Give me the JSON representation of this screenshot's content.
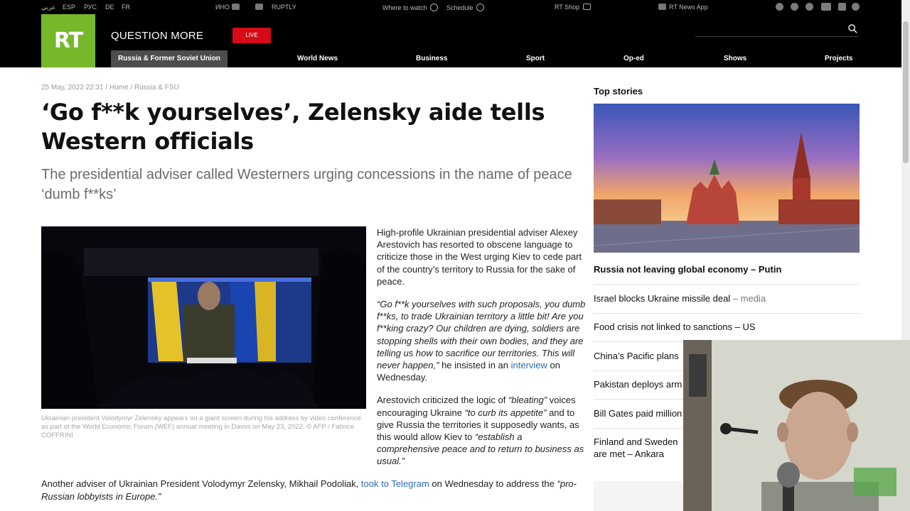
{
  "top_bar": {
    "languages": [
      "عربي",
      "ESP",
      "РУС",
      "DE",
      "FR"
    ],
    "partners": [
      "ИНО",
      "RUPTLY"
    ],
    "where_to_watch": "Where to watch",
    "schedule": "Schedule",
    "shop": "RT Shop",
    "news_app": "RT News App"
  },
  "header": {
    "logo": "RT",
    "tagline": "QUESTION MORE",
    "live_label": "LIVE",
    "search_placeholder": "",
    "nav": [
      "Russia & Former Soviet Union",
      "World News",
      "Business",
      "Sport",
      "Op-ed",
      "Shows",
      "Projects"
    ]
  },
  "article": {
    "meta": "25 May, 2022 22:31 / Home / Russia & FSU",
    "title": "‘Go f**k yourselves’, Zelensky aide tells Western officials",
    "subtitle": "The presidential adviser called Westerners urging concessions in the name of peace ‘dumb f**ks’",
    "caption": "Ukrainian president Volodymyr Zelensky appears on a giant screen during his address by video conference as part of the World Economic Forum (WEF) annual meeting in Davos on May 23, 2022. © AFP / Fabrice COFFRINI",
    "p1": "High-profile Ukrainian presidential adviser Alexey Arestovich has resorted to obscene language to criticize those in the West urging Kiev to cede part of the country’s territory to Russia for the sake of peace.",
    "p2_quote": "“Go f**k yourselves with such proposals, you dumb f**ks, to trade Ukrainian territory a little bit! Are you f**king crazy? Our children are dying, soldiers are stopping shells with their own bodies, and they are telling us how to sacrifice our territories. This will never happen,”",
    "p2_he": " he insisted in an ",
    "p2_link": "interview",
    "p2_end": " on Wednesday.",
    "p3_a": "Arestovich criticized the logic of ",
    "p3_q1": "“bleating”",
    "p3_b": " voices encouraging Ukraine ",
    "p3_q2": "“to curb its appetite”",
    "p3_c": " and to give Russia the territories it supposedly wants, as this would allow Kiev to ",
    "p3_q3": "“establish a comprehensive peace and to return to business as usual.”",
    "p4_a": "Another adviser of Ukrainian President Volodymyr Zelensky, Mikhail Podoliak, ",
    "p4_link": "took to Telegram",
    "p4_b": " on Wednesday to address the ",
    "p4_q": "“pro-Russian lobbyists in Europe.”"
  },
  "sidebar": {
    "title": "Top stories",
    "stories": [
      {
        "text": "Russia not leaving global economy – Putin",
        "tag": ""
      },
      {
        "text": "Israel blocks Ukraine missile deal",
        "tag": " – media"
      },
      {
        "text": "Food crisis not linked to sanctions – US",
        "tag": ""
      },
      {
        "text": "China’s Pacific plans",
        "tag": ""
      },
      {
        "text": "Pakistan deploys arm",
        "tag": ""
      },
      {
        "text": "Bill Gates paid million",
        "tag": ""
      },
      {
        "text": "Finland and Sweden are met – Ankara",
        "tag": ""
      }
    ]
  },
  "colors": {
    "brand_green": "#77b82a",
    "live_red": "#d60b17",
    "link_blue": "#2a6db5"
  }
}
